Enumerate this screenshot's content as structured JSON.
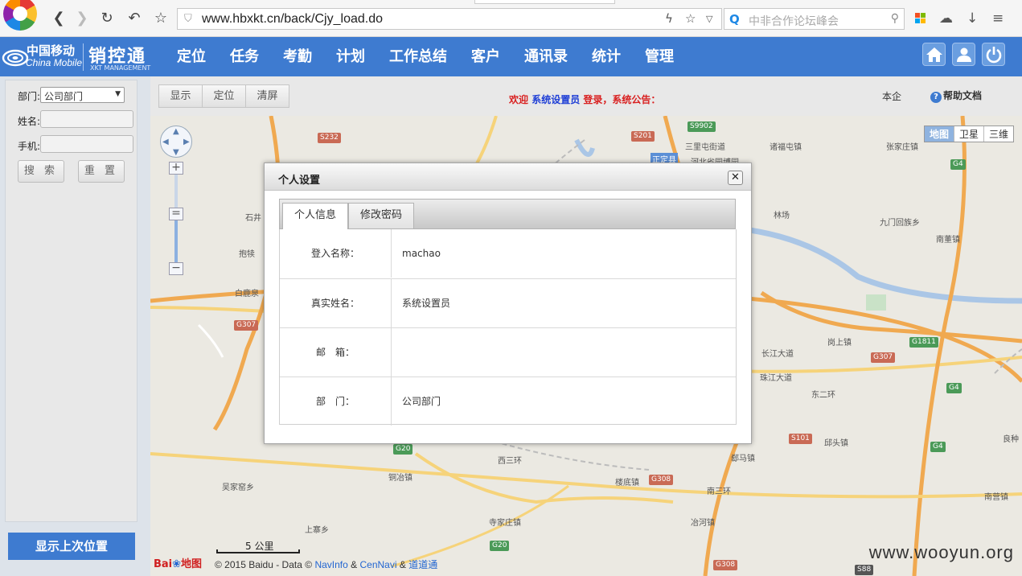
{
  "browser": {
    "url": "www.hbxkt.cn/back/Cjy_load.do",
    "search_placeholder": "中非合作论坛峰会"
  },
  "header": {
    "brand_cn": "中国移动",
    "brand_en": "China Mobile",
    "product_name": "销控通",
    "product_sub": "XKT MANAGEMENT",
    "nav": [
      "定位",
      "任务",
      "考勤",
      "计划",
      "工作总结",
      "客户",
      "通讯录",
      "统计",
      "管理"
    ]
  },
  "left_panel": {
    "dept_label": "部门:",
    "dept_value": "公司部门",
    "name_label": "姓名:",
    "phone_label": "手机:",
    "search_btn": "搜 索",
    "reset_btn": "重 置",
    "last_pos_btn": "显示上次位置"
  },
  "toolbar": {
    "show_btn": "显示",
    "locate_btn": "定位",
    "clear_btn": "清屏",
    "welcome_prefix": "欢迎",
    "welcome_user": "系统设置员",
    "welcome_suffix": "登录，系统公告：",
    "company_link": "本企",
    "help_link": "帮助文档"
  },
  "map": {
    "type_buttons": [
      "地图",
      "卫星",
      "三维"
    ],
    "active_type": "地图",
    "scale_label": "5 公里",
    "baidu_logo": "Bai",
    "baidu_map": "地图",
    "copyright_a": "© 2015 Baidu - Data ©",
    "copyright_navinfo": "NavInfo",
    "copyright_amp1": "&",
    "copyright_cennavi": "CenNavi",
    "copyright_amp2": "&",
    "copyright_dao": "道道通",
    "watermark": "www.wooyun.org",
    "place_labels": [
      "三里屯街道",
      "诸福屯镇",
      "张家庄镇",
      "河北省园博园",
      "正定县",
      "林场",
      "九门回族乡",
      "南董镇",
      "石井",
      "抱犊",
      "白鹿泉",
      "岗上镇",
      "长江大道",
      "珠江大道",
      "邱头镇",
      "郄马镇",
      "良种",
      "铜冶镇",
      "吴家窑乡",
      "楼底镇",
      "南三环",
      "西三环",
      "南营镇",
      "寺家庄镇",
      "冶河镇",
      "上寨乡",
      "东二环"
    ],
    "road_labels": [
      "S9902",
      "S232",
      "S201",
      "G4",
      "G307",
      "G1811",
      "G307",
      "G4",
      "S101",
      "G4",
      "G20",
      "G308",
      "G20",
      "G308",
      "S88"
    ]
  },
  "dialog": {
    "title": "个人设置",
    "close_icon": "close-icon",
    "tabs": [
      "个人信息",
      "修改密码"
    ],
    "active_tab": "个人信息",
    "rows": [
      {
        "label": "登入名称：",
        "value": "machao"
      },
      {
        "label": "真实姓名：",
        "value": "系统设置员"
      },
      {
        "label": "邮　箱：",
        "value": ""
      },
      {
        "label": "部　门：",
        "value": "公司部门"
      }
    ]
  },
  "colors": {
    "header_blue": "#3e7bd0",
    "welcome_red": "#d92020",
    "welcome_user_blue": "#1f3fd6"
  }
}
